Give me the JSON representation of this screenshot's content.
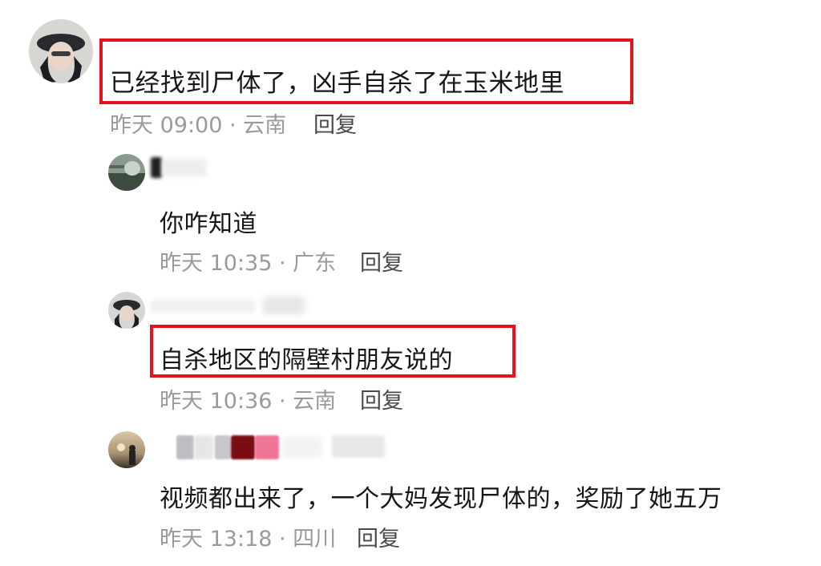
{
  "comments": [
    {
      "text": "已经找到尸体了，凶手自杀了在玉米地里",
      "time_location": "昨天 09:00 · 云南",
      "reply_label": "回复",
      "highlighted": true
    },
    {
      "text": "你咋知道",
      "time_location": "昨天 10:35 · 广东",
      "reply_label": "回复",
      "highlighted": false
    },
    {
      "text": "自杀地区的隔壁村朋友说的",
      "time_location": "昨天 10:36 · 云南",
      "reply_label": "回复",
      "highlighted": true
    },
    {
      "text": "视频都出来了，一个大妈发现尸体的，奖励了她五万",
      "time_location": "昨天 13:18 · 四川",
      "reply_label": "回复",
      "highlighted": false
    }
  ],
  "colors": {
    "highlight_border": "#e3141b",
    "meta_text": "#9a9a9a",
    "reply_text": "#4a4a4a",
    "body_text": "#161616"
  }
}
